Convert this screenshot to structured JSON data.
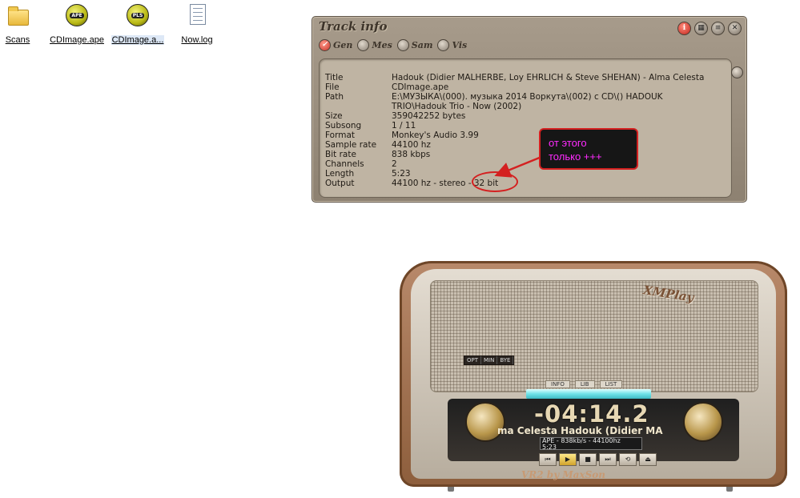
{
  "desktop": {
    "icons": [
      {
        "label": "Scans"
      },
      {
        "label": "CDImage.ape",
        "badge": "APE"
      },
      {
        "label": "CDImage.a...",
        "badge": "PLS"
      },
      {
        "label": "Now.log"
      }
    ]
  },
  "track_info": {
    "title": "Track info",
    "tabs": [
      "Gen",
      "Mes",
      "Sam",
      "Vis"
    ],
    "controls": [
      "i"
    ],
    "rows": [
      {
        "key": "Title",
        "value": "Hadouk (Didier MALHERBE, Loy EHRLICH & Steve SHEHAN) - Alma Celesta"
      },
      {
        "key": "File",
        "value": "CDImage.ape"
      },
      {
        "key": "Path",
        "value": "E:\\МУЗЫКА\\(000). музыка 2014 Воркута\\(002) с CD\\() HADOUK TRIO\\Hadouk Trio - Now (2002)"
      },
      {
        "key": "Size",
        "value": "359042252 bytes"
      },
      {
        "key": "Subsong",
        "value": "1 / 11"
      },
      {
        "key": "Format",
        "value": "Monkey's Audio 3.99"
      },
      {
        "key": "Sample rate",
        "value": "44100 hz"
      },
      {
        "key": "Bit rate",
        "value": "838 kbps"
      },
      {
        "key": "Channels",
        "value": "2"
      },
      {
        "key": "Length",
        "value": "5:23"
      },
      {
        "key": "Output",
        "value": "44100 hz - stereo - 32 bit"
      }
    ]
  },
  "annotation": {
    "line1": "от этого",
    "line2": "только +++"
  },
  "player": {
    "brand": "XMPlay",
    "small_buttons": [
      "OPT",
      "MIN",
      "BYE"
    ],
    "tabs": [
      "INFO",
      "LIB",
      "LIST"
    ],
    "time": "-04:14.2",
    "marquee": "ma Celesta     Hadouk (Didier MA",
    "status_line1": "APE - 838kb/s - 44100hz",
    "status_line2": "5:23",
    "footer": "VR2 by MaxSon"
  },
  "colors": {
    "annotation_text": "#ff2bff",
    "annotation_border": "#d42020",
    "window_bg": "#a79b8b"
  }
}
